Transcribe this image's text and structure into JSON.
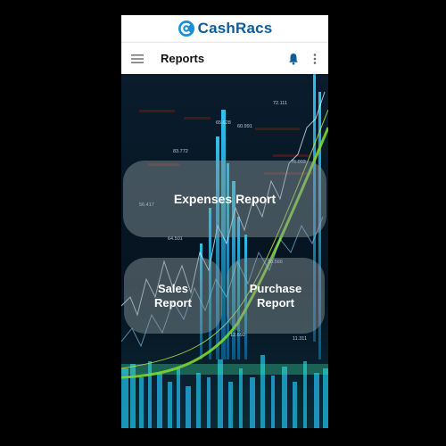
{
  "brand": {
    "name": "CashRacs",
    "color": "#0f5c9a"
  },
  "appbar": {
    "title": "Reports",
    "icons": {
      "menu": "hamburger-menu-icon",
      "notifications": "bell-icon",
      "more": "vertical-dots-icon"
    },
    "icon_color": "#0f5c9a"
  },
  "reports": {
    "expenses": "Expenses Report",
    "sales": "Sales\nReport",
    "purchase": "Purchase\nReport"
  },
  "background": {
    "description_colors": [
      "#04101c",
      "#1fb6e0",
      "#7fd62f"
    ],
    "ticker_values": [
      "65.628",
      "72.111",
      "60.991",
      "83.772",
      "64.501",
      "56.417",
      "76.003",
      "12.692",
      "11.311",
      "38.566"
    ]
  }
}
